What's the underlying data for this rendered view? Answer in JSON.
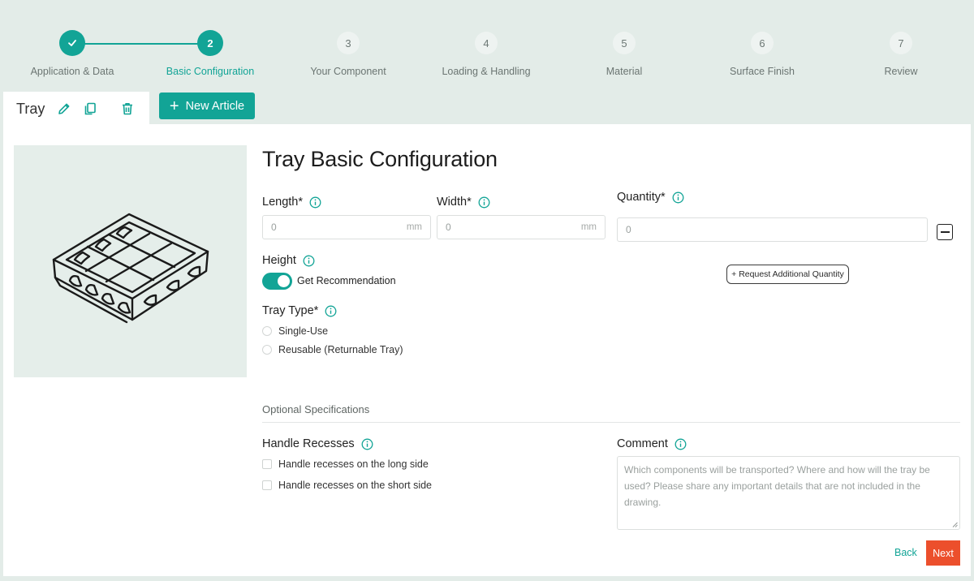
{
  "stepper": {
    "steps": [
      {
        "number": "",
        "label": "Application & Data",
        "state": "done"
      },
      {
        "number": "2",
        "label": "Basic Configuration",
        "state": "active"
      },
      {
        "number": "3",
        "label": "Your Component",
        "state": "pending"
      },
      {
        "number": "4",
        "label": "Loading & Handling",
        "state": "pending"
      },
      {
        "number": "5",
        "label": "Material",
        "state": "pending"
      },
      {
        "number": "6",
        "label": "Surface Finish",
        "state": "pending"
      },
      {
        "number": "7",
        "label": "Review",
        "state": "pending"
      }
    ]
  },
  "article_tab": {
    "name": "Tray",
    "icons": [
      "pencil-icon",
      "copy-icon",
      "trash-icon"
    ]
  },
  "new_article": {
    "label": "New Article",
    "icon": "plus-icon"
  },
  "form": {
    "title": "Tray Basic Configuration",
    "length": {
      "label": "Length*",
      "placeholder": "0",
      "unit": "mm"
    },
    "width": {
      "label": "Width*",
      "placeholder": "0",
      "unit": "mm"
    },
    "quantity": {
      "label": "Quantity*",
      "placeholder": "0"
    },
    "request_quantity_label": "+ Request Additional Quantity",
    "height": {
      "label": "Height",
      "toggle_label": "Get Recommendation",
      "toggle_on": true
    },
    "tray_type": {
      "label": "Tray Type*",
      "options": [
        "Single-Use",
        "Reusable (Returnable Tray)"
      ]
    },
    "optional_title": "Optional Specifications",
    "handle_recesses": {
      "label": "Handle Recesses",
      "options": [
        "Handle recesses on the long side",
        "Handle recesses on the short side"
      ]
    },
    "comment": {
      "label": "Comment",
      "placeholder": "Which components will be transported? Where and how will the tray be used? Please share any important details that are not included in the drawing."
    }
  },
  "nav": {
    "back_label": "Back",
    "next_label": "Next"
  },
  "colors": {
    "accent": "#12a496",
    "next": "#ec4f2c",
    "background": "#e3ece8"
  }
}
